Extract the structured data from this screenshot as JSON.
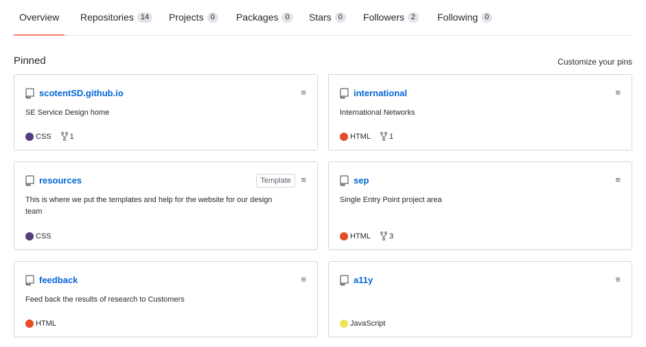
{
  "tabs": [
    {
      "label": "Overview",
      "count": null,
      "active": true
    },
    {
      "label": "Repositories",
      "count": "14"
    },
    {
      "label": "Projects",
      "count": "0"
    },
    {
      "label": "Packages",
      "count": "0"
    },
    {
      "label": "Stars",
      "count": "0"
    },
    {
      "label": "Followers",
      "count": "2"
    },
    {
      "label": "Following",
      "count": "0"
    }
  ],
  "pinned": {
    "title": "Pinned",
    "customize_label": "Customize your pins"
  },
  "colors": {
    "link": "#0366d6",
    "tab_underline": "#f9826c",
    "css": "#563d7c",
    "html": "#e34c26",
    "javascript": "#f1e05a"
  },
  "cards": [
    {
      "name": "scotentSD.github.io",
      "description": "SE Service Design home",
      "language": "CSS",
      "lang_color": "#563d7c",
      "forks": "1",
      "template": null
    },
    {
      "name": "international",
      "description": "International Networks",
      "language": "HTML",
      "lang_color": "#e34c26",
      "forks": "1",
      "template": null
    },
    {
      "name": "resources",
      "description": "This is where we put the templates and help for the website for our design team",
      "language": "CSS",
      "lang_color": "#563d7c",
      "forks": null,
      "template": "Template"
    },
    {
      "name": "sep",
      "description": "Single Entry Point project area",
      "language": "HTML",
      "lang_color": "#e34c26",
      "forks": "3",
      "template": null
    },
    {
      "name": "feedback",
      "description": "Feed back the results of research to Customers",
      "language": "HTML",
      "lang_color": "#e34c26",
      "forks": null,
      "template": null
    },
    {
      "name": "a11y",
      "description": "",
      "language": "JavaScript",
      "lang_color": "#f1e05a",
      "forks": null,
      "template": null
    }
  ],
  "icons": {
    "repo": "repo-icon",
    "fork": "fork-icon",
    "drag": "drag-handle-icon"
  }
}
